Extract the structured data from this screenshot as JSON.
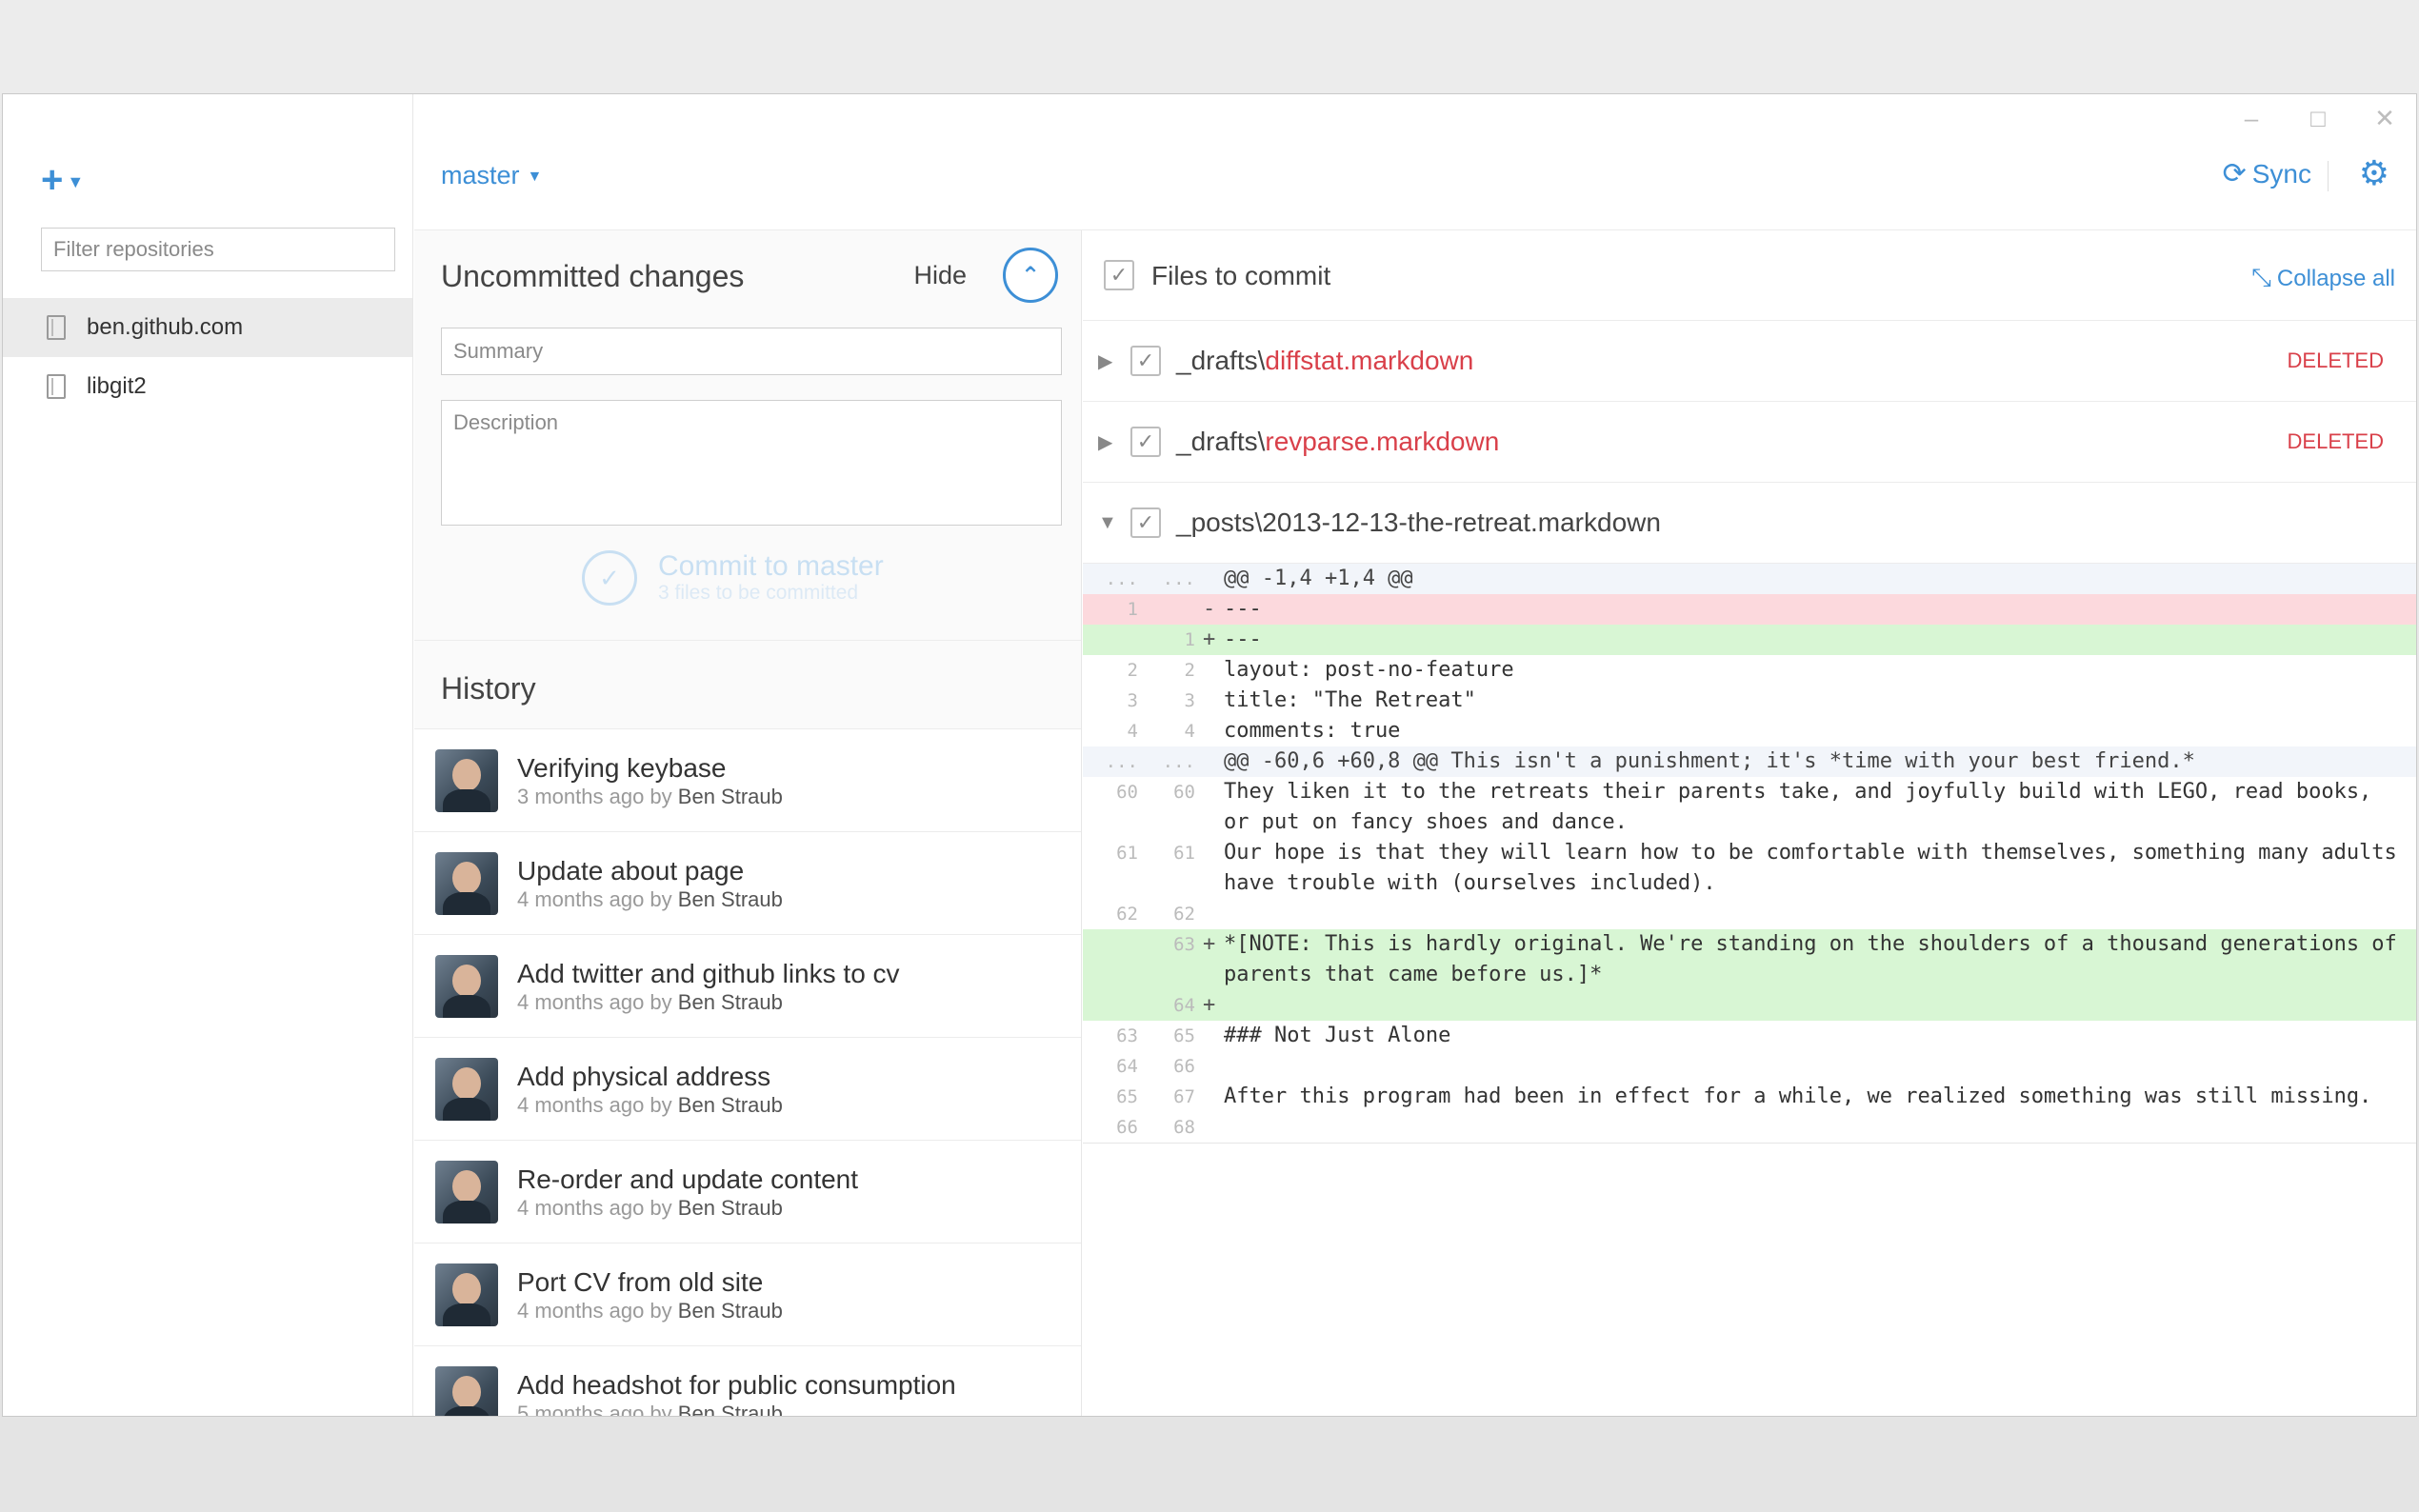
{
  "window": {
    "controls": [
      "–",
      "□",
      "✕"
    ]
  },
  "sidebar": {
    "add_label": "+",
    "filter_placeholder": "Filter repositories",
    "repos": [
      {
        "name": "ben.github.com",
        "selected": true
      },
      {
        "name": "libgit2",
        "selected": false
      }
    ]
  },
  "topbar": {
    "branch": "master",
    "sync_label": "Sync"
  },
  "uncommitted": {
    "title": "Uncommitted changes",
    "hide_label": "Hide",
    "summary_placeholder": "Summary",
    "description_placeholder": "Description",
    "commit_label": "Commit to master",
    "commit_sub": "3 files to be committed"
  },
  "history": {
    "title": "History",
    "items": [
      {
        "title": "Verifying keybase",
        "when": "3 months ago by",
        "author": "Ben Straub"
      },
      {
        "title": "Update about page",
        "when": "4 months ago by",
        "author": "Ben Straub"
      },
      {
        "title": "Add twitter and github links to cv",
        "when": "4 months ago by",
        "author": "Ben Straub"
      },
      {
        "title": "Add physical address",
        "when": "4 months ago by",
        "author": "Ben Straub"
      },
      {
        "title": "Re-order and update content",
        "when": "4 months ago by",
        "author": "Ben Straub"
      },
      {
        "title": "Port CV from old site",
        "when": "4 months ago by",
        "author": "Ben Straub"
      },
      {
        "title": "Add headshot for public consumption",
        "when": "5 months ago by",
        "author": "Ben Straub"
      }
    ]
  },
  "files": {
    "header_label": "Files to commit",
    "collapse_label": "Collapse all",
    "rows": [
      {
        "dir": "_drafts\\",
        "name": "diffstat.markdown",
        "status": "DELETED",
        "expanded": false
      },
      {
        "dir": "_drafts\\",
        "name": "revparse.markdown",
        "status": "DELETED",
        "expanded": false
      },
      {
        "dir": "_posts\\",
        "name": "2013-12-13-the-retreat.markdown",
        "status": "",
        "expanded": true
      }
    ]
  },
  "diff": [
    {
      "type": "hunk",
      "old": "...",
      "new": "...",
      "mark": "",
      "text": "@@ -1,4 +1,4 @@"
    },
    {
      "type": "del",
      "old": "1",
      "new": "",
      "mark": "-",
      "text": "---"
    },
    {
      "type": "add",
      "old": "",
      "new": "1",
      "mark": "+",
      "text": "---"
    },
    {
      "type": "ctx",
      "old": "2",
      "new": "2",
      "mark": "",
      "text": "layout: post-no-feature"
    },
    {
      "type": "ctx",
      "old": "3",
      "new": "3",
      "mark": "",
      "text": "title: \"The Retreat\""
    },
    {
      "type": "ctx",
      "old": "4",
      "new": "4",
      "mark": "",
      "text": "comments: true"
    },
    {
      "type": "hunk",
      "old": "...",
      "new": "...",
      "mark": "",
      "text": "@@ -60,6 +60,8 @@ This isn't a punishment; it's *time with your best friend.*"
    },
    {
      "type": "ctx",
      "old": "60",
      "new": "60",
      "mark": "",
      "text": "They liken it to the retreats their parents take, and joyfully build with LEGO, read books, or put on fancy shoes and dance."
    },
    {
      "type": "ctx",
      "old": "61",
      "new": "61",
      "mark": "",
      "text": "Our hope is that they will learn how to be comfortable with themselves, something many adults have trouble with (ourselves included)."
    },
    {
      "type": "ctx",
      "old": "62",
      "new": "62",
      "mark": "",
      "text": ""
    },
    {
      "type": "add",
      "old": "",
      "new": "63",
      "mark": "+",
      "text": "*[NOTE: This is hardly original. We're standing on the shoulders of a thousand generations of parents that came before us.]*"
    },
    {
      "type": "add",
      "old": "",
      "new": "64",
      "mark": "+",
      "text": ""
    },
    {
      "type": "ctx",
      "old": "63",
      "new": "65",
      "mark": "",
      "text": "### Not Just Alone"
    },
    {
      "type": "ctx",
      "old": "64",
      "new": "66",
      "mark": "",
      "text": ""
    },
    {
      "type": "ctx",
      "old": "65",
      "new": "67",
      "mark": "",
      "text": "After this program had been in effect for a while, we realized something was still missing."
    },
    {
      "type": "ctx",
      "old": "66",
      "new": "68",
      "mark": "",
      "text": ""
    }
  ]
}
